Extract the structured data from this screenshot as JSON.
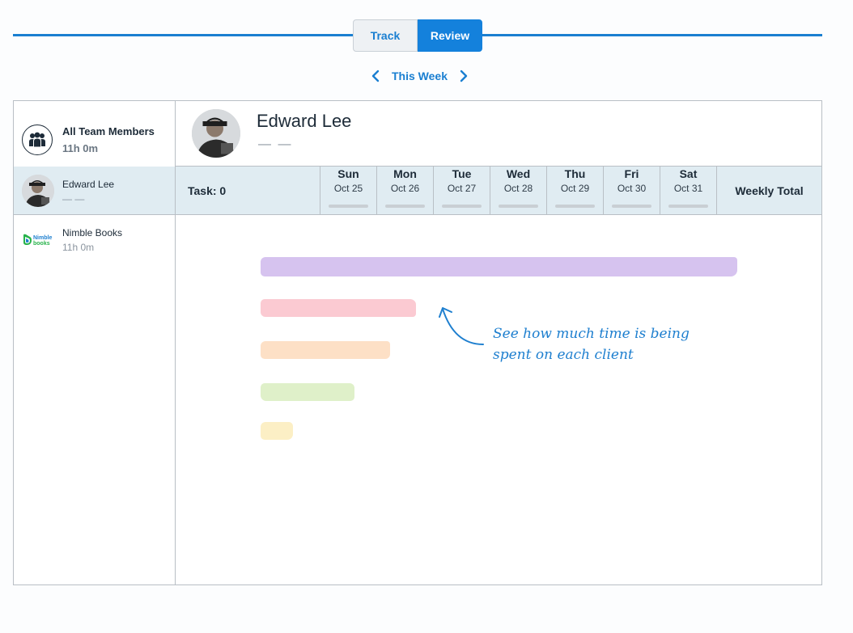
{
  "mode_tabs": {
    "track": "Track",
    "review": "Review",
    "active": "Review"
  },
  "week_nav": {
    "label": "This Week"
  },
  "sidebar": {
    "all_team": {
      "name": "All Team Members",
      "hours": "11h 0m"
    },
    "members": [
      {
        "name": "Edward Lee",
        "sub": "— —"
      },
      {
        "name": "Nimble Books",
        "sub": "11h 0m"
      }
    ]
  },
  "user_header": {
    "name": "Edward Lee",
    "sub": "— —"
  },
  "day_header": {
    "task_label": "Task: 0",
    "days": [
      {
        "day": "Sun",
        "date": "Oct 25"
      },
      {
        "day": "Mon",
        "date": "Oct 26"
      },
      {
        "day": "Tue",
        "date": "Oct 27"
      },
      {
        "day": "Wed",
        "date": "Oct 28"
      },
      {
        "day": "Thu",
        "date": "Oct 29"
      },
      {
        "day": "Fri",
        "date": "Oct 30"
      },
      {
        "day": "Sat",
        "date": "Oct 31"
      }
    ],
    "weekly_total": "Weekly Total"
  },
  "empty_state": {
    "message": "See how much time is being spent on each client",
    "colors": [
      "#d6c3ef",
      "#fbcad2",
      "#fde0c6",
      "#dff0c9",
      "#fcefc5"
    ]
  },
  "theme": {
    "accent": "#1481dc",
    "row_highlight": "#e0ecf2"
  }
}
